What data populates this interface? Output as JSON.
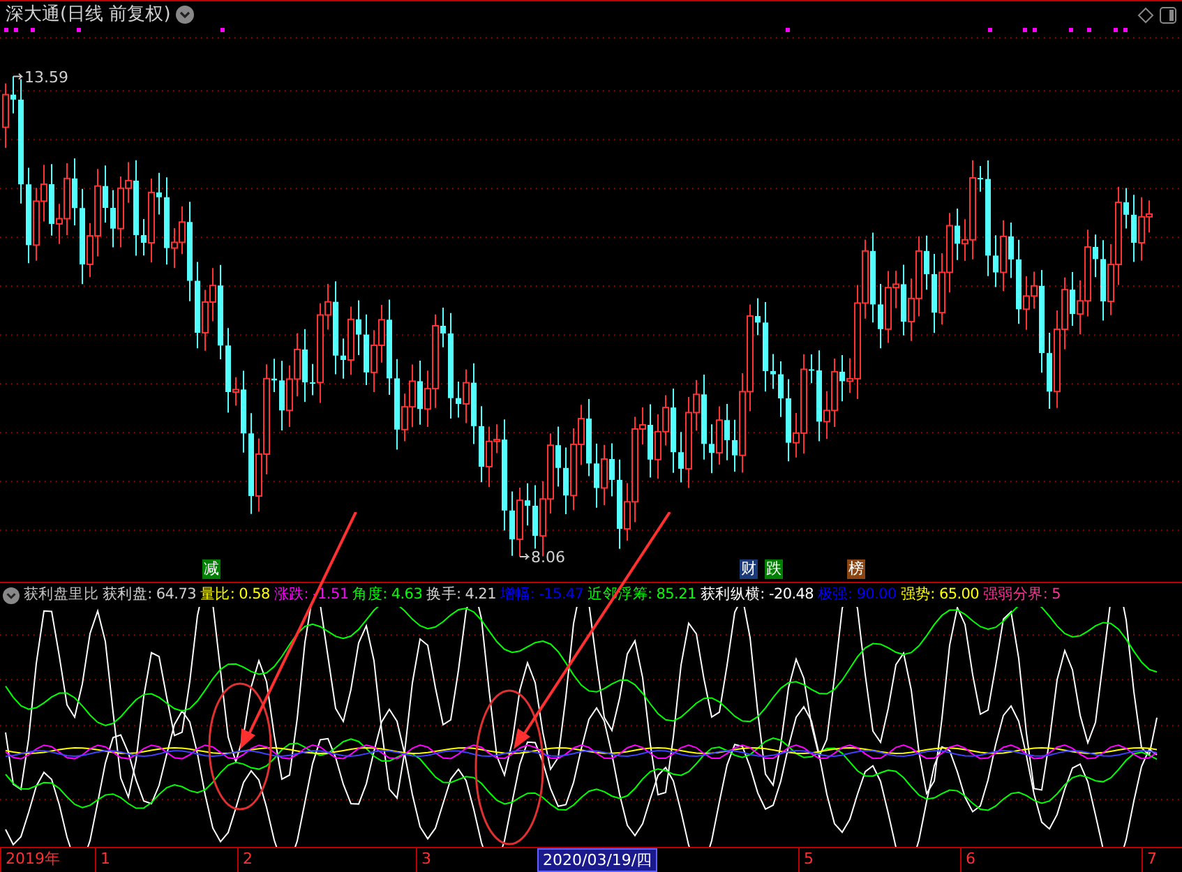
{
  "title": "深大通(日线 前复权)",
  "price_high": "13.59",
  "price_low": "8.06",
  "signals": [
    {
      "text": "减",
      "color": "#008000"
    },
    {
      "text": "财",
      "color": "#1a3a7a"
    },
    {
      "text": "跌",
      "color": "#008000"
    },
    {
      "text": "榜",
      "color": "#8b4513"
    }
  ],
  "indicator": {
    "name": "获利盘里比",
    "fields": [
      {
        "label": "获利盘:",
        "value": "64.73",
        "color": "#d0d0d0"
      },
      {
        "label": "量比:",
        "value": "0.58",
        "color": "#ffff00"
      },
      {
        "label": "涨跌:",
        "value": "-1.51",
        "color": "#ff00ff"
      },
      {
        "label": "角度:",
        "value": "4.63",
        "color": "#00ff00"
      },
      {
        "label": "换手:",
        "value": "4.21",
        "color": "#d0d0d0"
      },
      {
        "label": "增幅:",
        "value": "-15.47",
        "color": "#0000ff"
      },
      {
        "label": "近邻浮筹:",
        "value": "85.21",
        "color": "#00ff00"
      },
      {
        "label": "获利纵横:",
        "value": "-20.48",
        "color": "#ffffff"
      },
      {
        "label": "极强:",
        "value": "90.00",
        "color": "#0000ff"
      },
      {
        "label": "强势:",
        "value": "65.00",
        "color": "#ffff00"
      },
      {
        "label": "强弱分界:",
        "value": "5",
        "color": "#ff3399"
      }
    ]
  },
  "axis": [
    {
      "label": "2019年",
      "selected": false
    },
    {
      "label": "1",
      "selected": false
    },
    {
      "label": "2",
      "selected": false
    },
    {
      "label": "3",
      "selected": false
    },
    {
      "label": "2020/03/19/四",
      "selected": true
    },
    {
      "label": "5",
      "selected": false
    },
    {
      "label": "6",
      "selected": false
    },
    {
      "label": "7",
      "selected": false
    }
  ]
}
